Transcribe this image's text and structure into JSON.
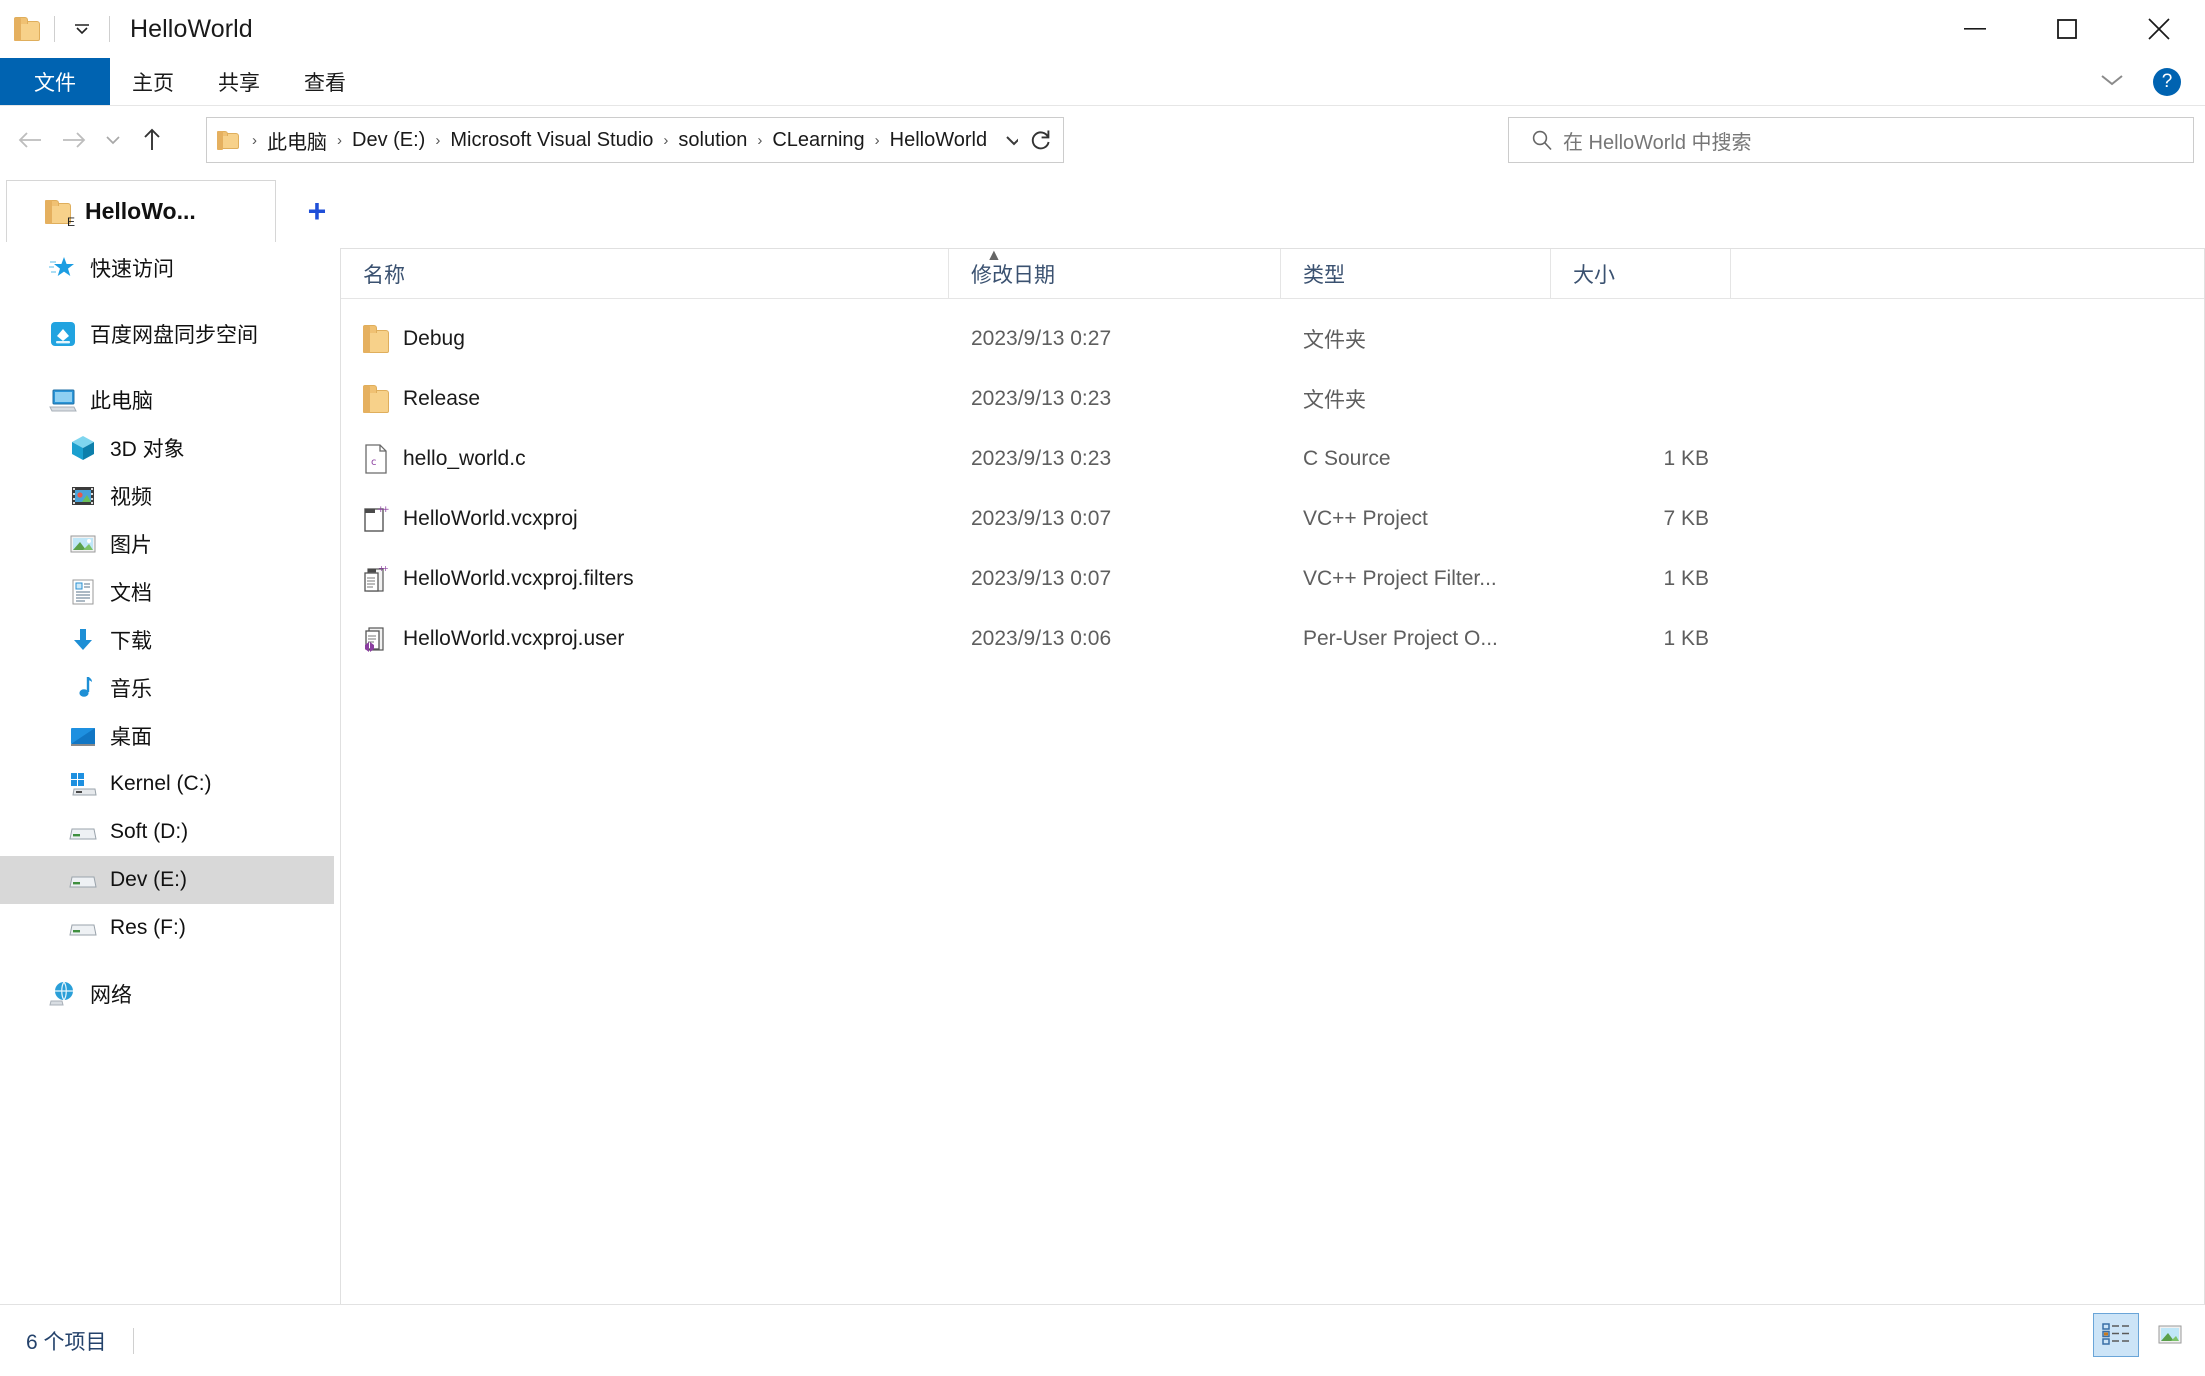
{
  "window": {
    "title": "HelloWorld",
    "folder_icon": "folder-icon",
    "dropdown_icon": "chevron-down-icon",
    "minimize_icon": "minimize-icon",
    "maximize_icon": "maximize-icon",
    "close_icon": "close-icon"
  },
  "ribbon": {
    "tabs": [
      {
        "label": "文件",
        "active": true
      },
      {
        "label": "主页",
        "active": false
      },
      {
        "label": "共享",
        "active": false
      },
      {
        "label": "查看",
        "active": false
      }
    ],
    "collapse_icon": "chevron-down-icon",
    "help_label": "?",
    "accent_color": "#0063b1"
  },
  "address": {
    "back_icon": "arrow-left-icon",
    "forward_icon": "arrow-right-icon",
    "recent_icon": "chevron-down-icon",
    "up_icon": "arrow-up-icon",
    "breadcrumbs": [
      "此电脑",
      "Dev (E:)",
      "Microsoft Visual Studio",
      "solution",
      "CLearning",
      "HelloWorld"
    ],
    "separator": "›",
    "dropdown_icon": "chevron-down-icon",
    "refresh_icon": "refresh-icon"
  },
  "search": {
    "icon": "search-icon",
    "placeholder": "在 HelloWorld 中搜索",
    "value": ""
  },
  "tabstrip": {
    "tabs": [
      {
        "label": "HelloWo...",
        "icon": "folder-drive-e-icon",
        "active": true
      }
    ],
    "new_tab_label": "+"
  },
  "sidebar": {
    "items": [
      {
        "label": "快速访问",
        "icon": "star-pin-icon",
        "level": 0,
        "selected": false,
        "spacer_after": true
      },
      {
        "label": "百度网盘同步空间",
        "icon": "baidu-netdisk-icon",
        "level": 0,
        "selected": false,
        "spacer_after": true
      },
      {
        "label": "此电脑",
        "icon": "this-pc-icon",
        "level": 0,
        "selected": false,
        "spacer_after": false
      },
      {
        "label": "3D 对象",
        "icon": "3d-objects-icon",
        "level": 1,
        "selected": false,
        "spacer_after": false
      },
      {
        "label": "视频",
        "icon": "videos-icon",
        "level": 1,
        "selected": false,
        "spacer_after": false
      },
      {
        "label": "图片",
        "icon": "pictures-icon",
        "level": 1,
        "selected": false,
        "spacer_after": false
      },
      {
        "label": "文档",
        "icon": "documents-icon",
        "level": 1,
        "selected": false,
        "spacer_after": false
      },
      {
        "label": "下载",
        "icon": "downloads-icon",
        "level": 1,
        "selected": false,
        "spacer_after": false
      },
      {
        "label": "音乐",
        "icon": "music-icon",
        "level": 1,
        "selected": false,
        "spacer_after": false
      },
      {
        "label": "桌面",
        "icon": "desktop-icon",
        "level": 1,
        "selected": false,
        "spacer_after": false
      },
      {
        "label": "Kernel (C:)",
        "icon": "windows-drive-icon",
        "level": 1,
        "selected": false,
        "spacer_after": false
      },
      {
        "label": "Soft (D:)",
        "icon": "drive-icon",
        "level": 1,
        "selected": false,
        "spacer_after": false
      },
      {
        "label": "Dev (E:)",
        "icon": "drive-icon",
        "level": 1,
        "selected": true,
        "spacer_after": false
      },
      {
        "label": "Res (F:)",
        "icon": "drive-icon",
        "level": 1,
        "selected": false,
        "spacer_after": true
      },
      {
        "label": "网络",
        "icon": "network-icon",
        "level": 0,
        "selected": false,
        "spacer_after": false
      }
    ]
  },
  "filelist": {
    "columns": [
      {
        "key": "name",
        "label": "名称"
      },
      {
        "key": "date",
        "label": "修改日期"
      },
      {
        "key": "type",
        "label": "类型"
      },
      {
        "key": "size",
        "label": "大小"
      }
    ],
    "sort_column": "name",
    "sort_direction": "ascending",
    "sort_indicator": "▲",
    "rows": [
      {
        "name": "Debug",
        "date": "2023/9/13 0:27",
        "type": "文件夹",
        "size": "",
        "icon": "folder-icon"
      },
      {
        "name": "Release",
        "date": "2023/9/13 0:23",
        "type": "文件夹",
        "size": "",
        "icon": "folder-icon"
      },
      {
        "name": "hello_world.c",
        "date": "2023/9/13 0:23",
        "type": "C Source",
        "size": "1 KB",
        "icon": "c-source-file-icon"
      },
      {
        "name": "HelloWorld.vcxproj",
        "date": "2023/9/13 0:07",
        "type": "VC++ Project",
        "size": "7 KB",
        "icon": "vcxproj-file-icon"
      },
      {
        "name": "HelloWorld.vcxproj.filters",
        "date": "2023/9/13 0:07",
        "type": "VC++ Project Filter...",
        "size": "1 KB",
        "icon": "vcxproj-filters-file-icon"
      },
      {
        "name": "HelloWorld.vcxproj.user",
        "date": "2023/9/13 0:06",
        "type": "Per-User Project O...",
        "size": "1 KB",
        "icon": "vcxproj-user-file-icon"
      }
    ]
  },
  "statusbar": {
    "item_count": "6 个项目",
    "view_details_icon": "details-view-icon",
    "view_thumbnails_icon": "thumbnail-view-icon",
    "active_view": "details"
  }
}
